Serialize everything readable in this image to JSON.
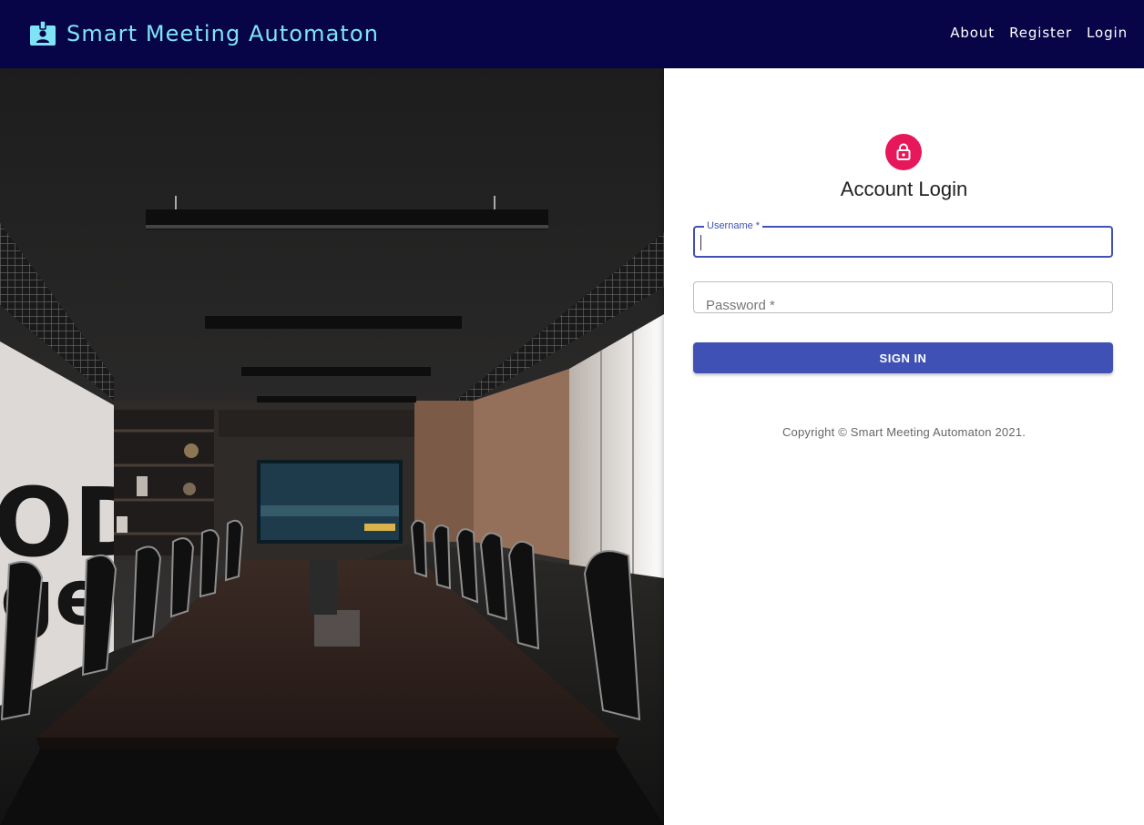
{
  "header": {
    "title": "Smart Meeting Automaton",
    "nav": [
      "About",
      "Register",
      "Login"
    ]
  },
  "login": {
    "title": "Account Login",
    "username_label": "Username *",
    "password_label": "Password *",
    "submit_label": "SIGN IN",
    "copyright": "Copyright © Smart Meeting Automaton 2021."
  },
  "colors": {
    "appbar": "#070548",
    "brand_text": "#7fe3f6",
    "primary": "#3f51b5",
    "accent": "#e6175a"
  },
  "icons": {
    "brand": "contact-badge-icon",
    "avatar": "lock-open-icon"
  },
  "hero_image": {
    "text_fragments": [
      "OD",
      "ge"
    ]
  }
}
